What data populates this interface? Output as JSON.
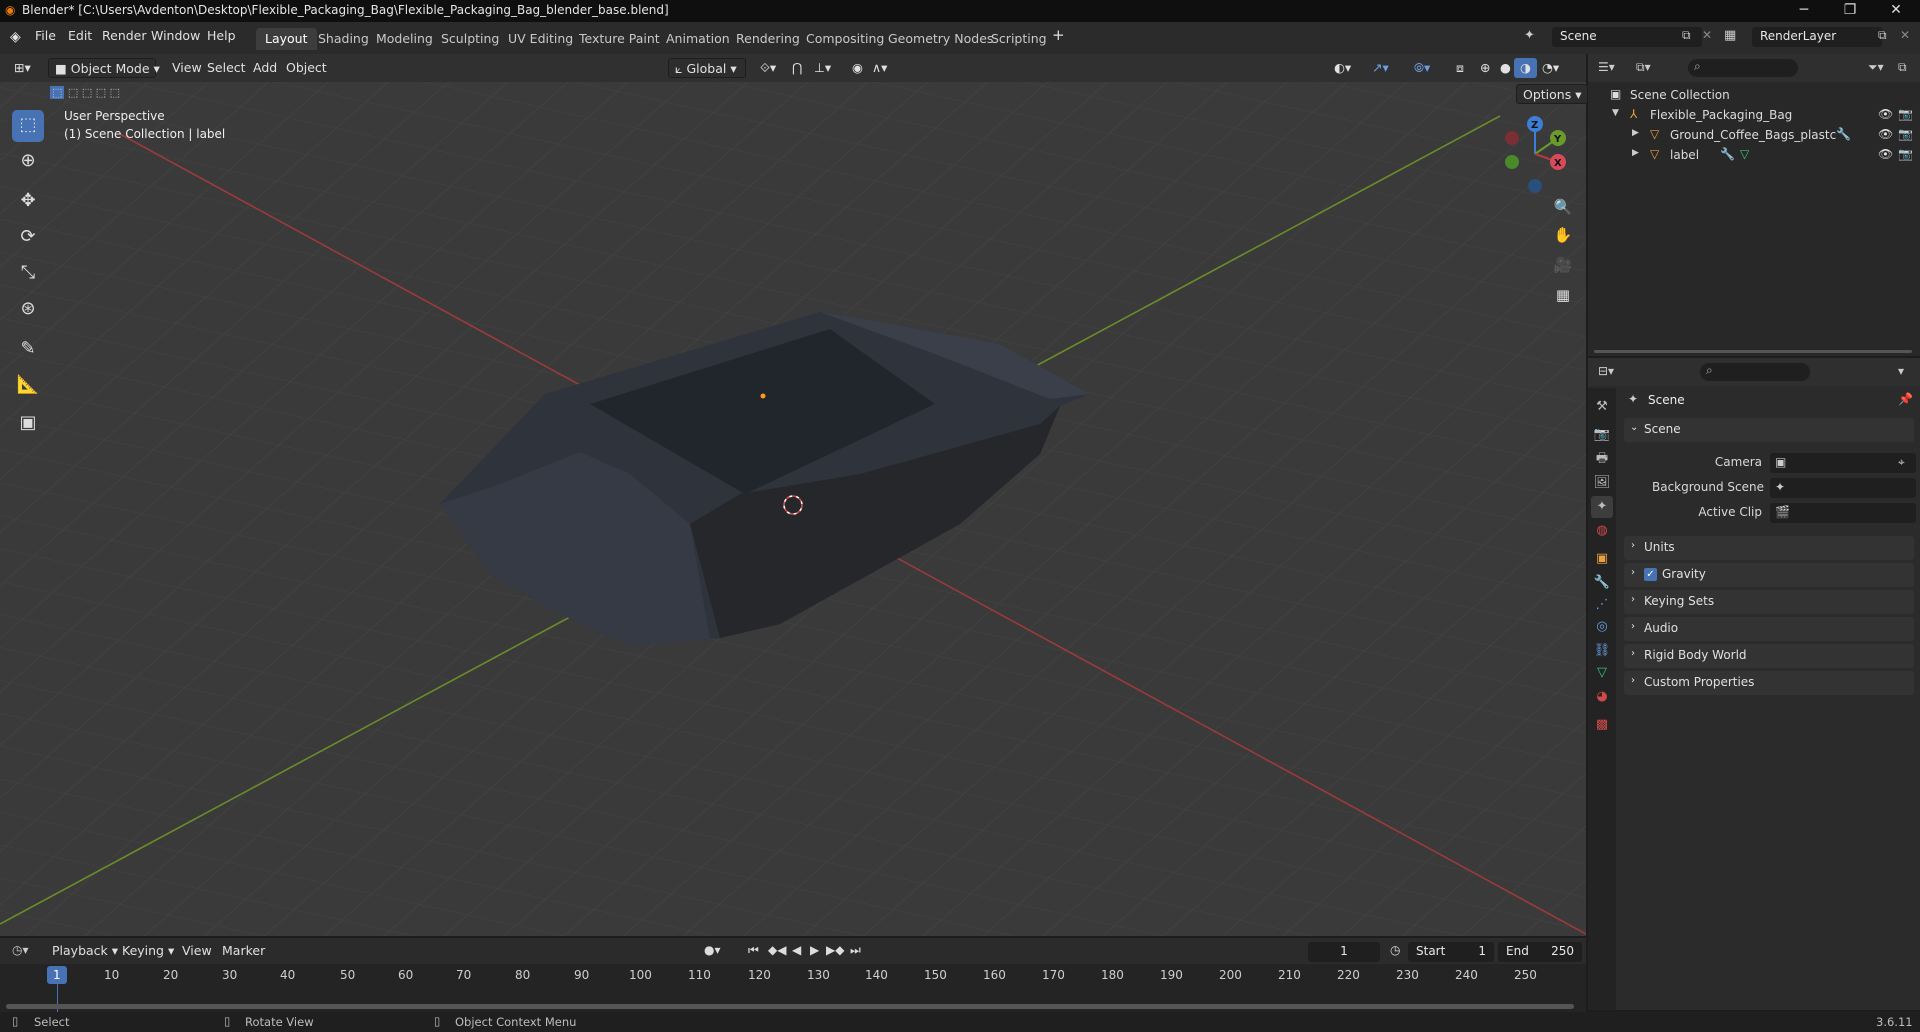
{
  "window": {
    "title": "Blender* [C:\\Users\\Avdenton\\Desktop\\Flexible_Packaging_Bag\\Flexible_Packaging_Bag_blender_base.blend]",
    "minimize": "─",
    "maximize": "❐",
    "close": "✕"
  },
  "menu": {
    "items": [
      "File",
      "Edit",
      "Render",
      "Window",
      "Help"
    ]
  },
  "workspaces": {
    "tabs": [
      "Layout",
      "Shading",
      "Modeling",
      "Sculpting",
      "UV Editing",
      "Texture Paint",
      "Animation",
      "Rendering",
      "Compositing",
      "Geometry Nodes",
      "Scripting"
    ],
    "active": "Layout",
    "add": "+"
  },
  "scene_selector": {
    "value": "Scene"
  },
  "layer_selector": {
    "value": "RenderLayer"
  },
  "viewport_header": {
    "mode": "Object Mode",
    "menus": [
      "View",
      "Select",
      "Add",
      "Object"
    ],
    "transform_orientation": "Global",
    "options": "Options"
  },
  "viewport": {
    "perspective": "User Perspective",
    "collection_info": "(1) Scene Collection | label",
    "gizmo": {
      "z": "Z",
      "y": "Y",
      "x": "X"
    }
  },
  "tools": [
    "select-box-icon",
    "cursor-icon",
    "move-icon",
    "rotate-icon",
    "scale-icon",
    "transform-icon",
    "annotate-icon",
    "measure-icon",
    "add-cube-icon"
  ],
  "outliner": {
    "root": "Scene Collection",
    "items": [
      {
        "name": "Flexible_Packaging_Bag",
        "level": 1
      },
      {
        "name": "Ground_Coffee_Bags_plastc",
        "level": 2
      },
      {
        "name": "label",
        "level": 2
      }
    ]
  },
  "properties": {
    "context": "Scene",
    "section": "Scene",
    "fields": [
      {
        "label": "Camera"
      },
      {
        "label": "Background Scene"
      },
      {
        "label": "Active Clip"
      }
    ],
    "panels": [
      "Units",
      "Gravity",
      "Keying Sets",
      "Audio",
      "Rigid Body World",
      "Custom Properties"
    ],
    "gravity_checked": true
  },
  "timeline": {
    "menus": [
      "Playback",
      "Keying",
      "View",
      "Marker"
    ],
    "current_frame": "1",
    "start_label": "Start",
    "start": "1",
    "end_label": "End",
    "end": "250",
    "ticks": [
      "1",
      "10",
      "20",
      "30",
      "40",
      "50",
      "60",
      "70",
      "80",
      "90",
      "100",
      "110",
      "120",
      "130",
      "140",
      "150",
      "160",
      "170",
      "180",
      "190",
      "200",
      "210",
      "220",
      "230",
      "240",
      "250"
    ]
  },
  "statusbar": {
    "select": "Select",
    "rotate": "Rotate View",
    "context_menu": "Object Context Menu",
    "version": "3.6.11"
  },
  "colors": {
    "accent": "#4772b3",
    "x_axis": "#b33a3a",
    "y_axis": "#6a9b2a",
    "z_axis": "#3c7fd6"
  }
}
